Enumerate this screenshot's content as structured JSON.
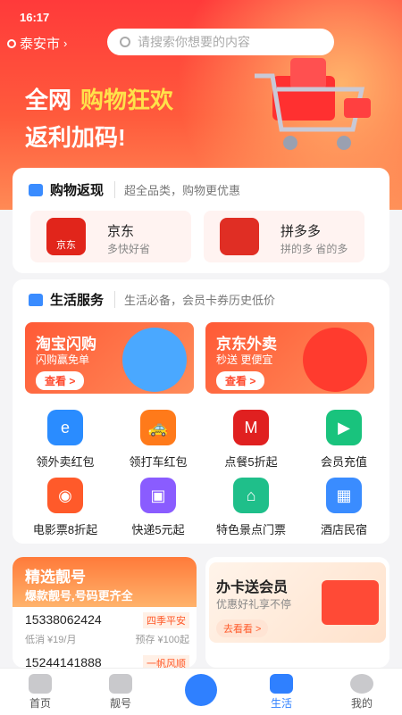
{
  "status": {
    "time": "16:17"
  },
  "location": {
    "city": "泰安市"
  },
  "search": {
    "placeholder": "请搜索你想要的内容"
  },
  "banner": {
    "line1_white": "全网",
    "line1_yellow": "购物狂欢",
    "line2": "返利加码!"
  },
  "rebate": {
    "title": "购物返现",
    "subtitle": "超全品类，购物更优惠",
    "shops": [
      {
        "name": "京东",
        "desc": "多快好省",
        "logo_text": "京东"
      },
      {
        "name": "拼多多",
        "desc": "拼的多 省的多",
        "logo_text": ""
      }
    ]
  },
  "life": {
    "title": "生活服务",
    "subtitle": "生活必备，会员卡券历史低价",
    "promos": [
      {
        "title": "淘宝闪购",
        "sub": "闪购赢免单",
        "button": "查看 >"
      },
      {
        "title": "京东外卖",
        "sub": "秒送 更便宜",
        "button": "查看 >"
      }
    ],
    "grid": [
      {
        "label": "领外卖红包",
        "icon": "coupon-food-icon",
        "color": "#2a8cff"
      },
      {
        "label": "领打车红包",
        "icon": "taxi-icon",
        "color": "#ff7a1a"
      },
      {
        "label": "点餐5折起",
        "icon": "fastfood-brands-icon",
        "color": "#e02020"
      },
      {
        "label": "会员充值",
        "icon": "video-vip-icon",
        "color": "#19c37d"
      },
      {
        "label": "电影票8折起",
        "icon": "film-reel-icon",
        "color": "#ff5a2a"
      },
      {
        "label": "快递5元起",
        "icon": "package-icon",
        "color": "#8a5cff"
      },
      {
        "label": "特色景点门票",
        "icon": "scenic-ticket-icon",
        "color": "#1fbf8a"
      },
      {
        "label": "酒店民宿",
        "icon": "hotel-icon",
        "color": "#3a8cff"
      }
    ]
  },
  "numbers": {
    "title": "精选靓号",
    "subtitle": "爆款靓号,号码更齐全",
    "items": [
      {
        "number": "15338062424",
        "tag": "四季平安",
        "price_low": "低消 ¥19/月",
        "prepay": "预存 ¥100起"
      },
      {
        "number": "15244141888",
        "tag": "一帆风顺"
      }
    ]
  },
  "vip_card": {
    "title": "办卡送会员",
    "sub": "优惠好礼享不停",
    "button": "去看看 >"
  },
  "tabs": [
    {
      "label": "首页"
    },
    {
      "label": "靓号"
    },
    {
      "label": ""
    },
    {
      "label": "生活"
    },
    {
      "label": "我的"
    }
  ]
}
